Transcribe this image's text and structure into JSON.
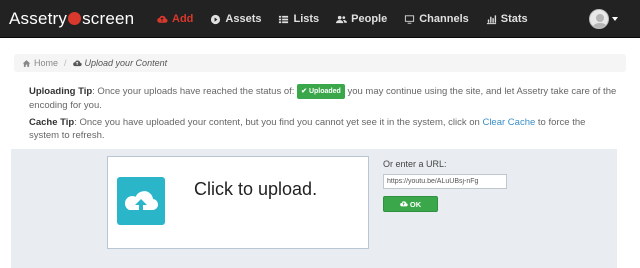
{
  "brand": {
    "name_part1": "Assetry",
    "name_part2": "screen"
  },
  "nav": {
    "items": [
      {
        "label": "Add",
        "icon": "cloud-upload-icon",
        "active": true
      },
      {
        "label": "Assets",
        "icon": "play-circle-icon",
        "active": false
      },
      {
        "label": "Lists",
        "icon": "list-icon",
        "active": false
      },
      {
        "label": "People",
        "icon": "users-icon",
        "active": false
      },
      {
        "label": "Channels",
        "icon": "monitor-icon",
        "active": false
      },
      {
        "label": "Stats",
        "icon": "bar-chart-icon",
        "active": false
      }
    ],
    "active_color": "#d9382c"
  },
  "breadcrumb": {
    "home": "Home",
    "current": "Upload your Content"
  },
  "tips": {
    "upload": {
      "title": "Uploading Tip",
      "text_before": ": Once your uploads have reached the status of:",
      "badge": "Uploaded",
      "text_after": "you may continue using the site, and let Assetry take care of the encoding for you."
    },
    "cache": {
      "title": "Cache Tip",
      "text_before": ": Once you have uploaded your content, but you find you cannot yet see it in the system, click on",
      "link": "Clear Cache",
      "text_after": "to force the system to refresh."
    }
  },
  "upload": {
    "prompt": "Click to upload.",
    "url_label": "Or enter a URL:",
    "url_value": "https://youtu.be/ALuUBsj-nFg",
    "ok_label": "OK"
  },
  "colors": {
    "navbar": "#222222",
    "accent": "#d9382c",
    "success": "#3aa84a",
    "upload_icon": "#2ab5c9",
    "link": "#3a8fc7"
  }
}
